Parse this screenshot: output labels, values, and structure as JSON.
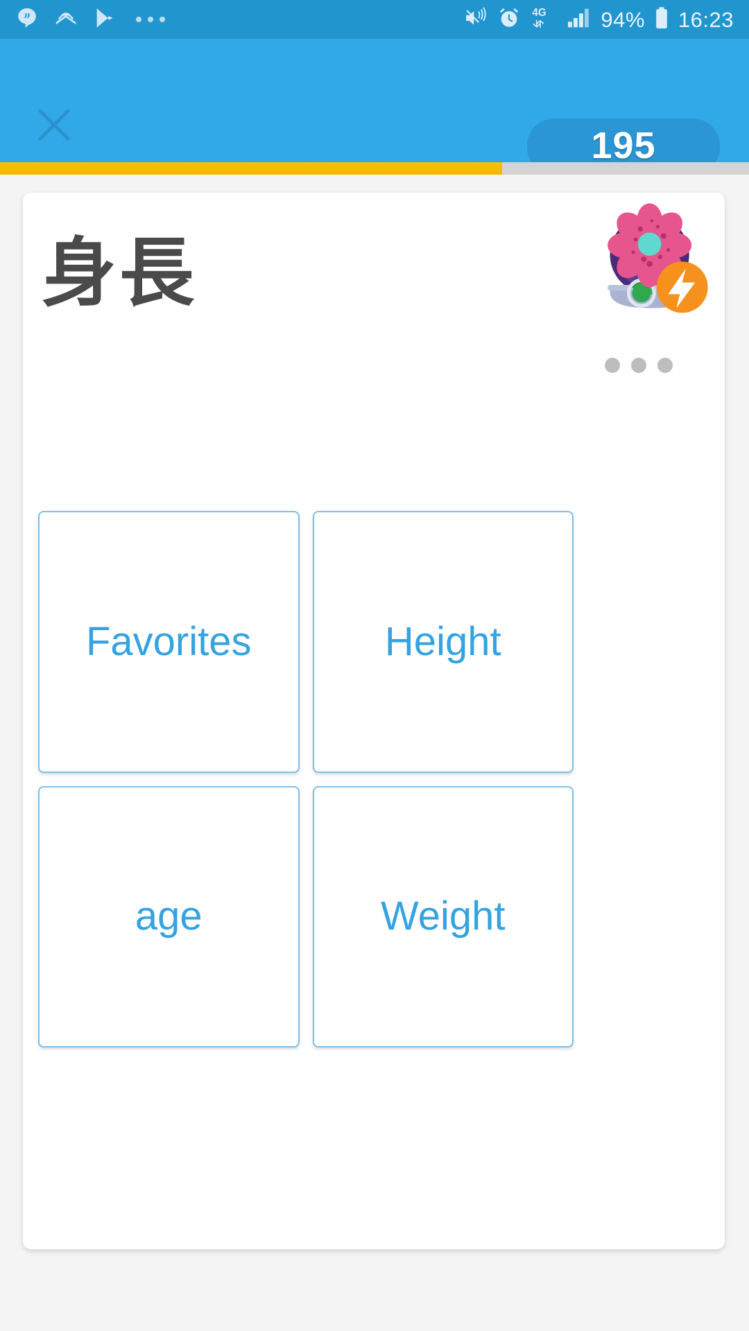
{
  "status_bar": {
    "notification_icons": [
      {
        "name": "hangouts-icon",
        "label": "Hangouts"
      },
      {
        "name": "audible-icon",
        "label": "Audible"
      },
      {
        "name": "play-store-icon",
        "label": "Play Store"
      },
      {
        "name": "more-notifications-icon",
        "label": "More notifications"
      }
    ],
    "mute_icon": "volume-mute-vibrate-icon",
    "alarm_icon": "alarm-clock-icon",
    "network_type": "4G",
    "signal_icon": "signal-bars-icon",
    "battery_percent": "94%",
    "battery_icon": "battery-icon",
    "time": "16:23"
  },
  "header": {
    "close_label": "✕",
    "close_icon": "close-icon",
    "points": "195",
    "bar_color": "#31a8e8"
  },
  "progress": {
    "percent": 67,
    "fill_color": "#f5c000",
    "track_color": "#d4d4d4"
  },
  "card": {
    "prompt": "身長",
    "avatar_icon": "flower-avatar-icon",
    "avatar_badge_icon": "lightning-bolt-icon",
    "overflow_icon": "overflow-dots-icon",
    "accent_color": "#34a3e0"
  },
  "answers": [
    {
      "label": "Favorites"
    },
    {
      "label": "Height"
    },
    {
      "label": "age"
    },
    {
      "label": "Weight"
    }
  ]
}
